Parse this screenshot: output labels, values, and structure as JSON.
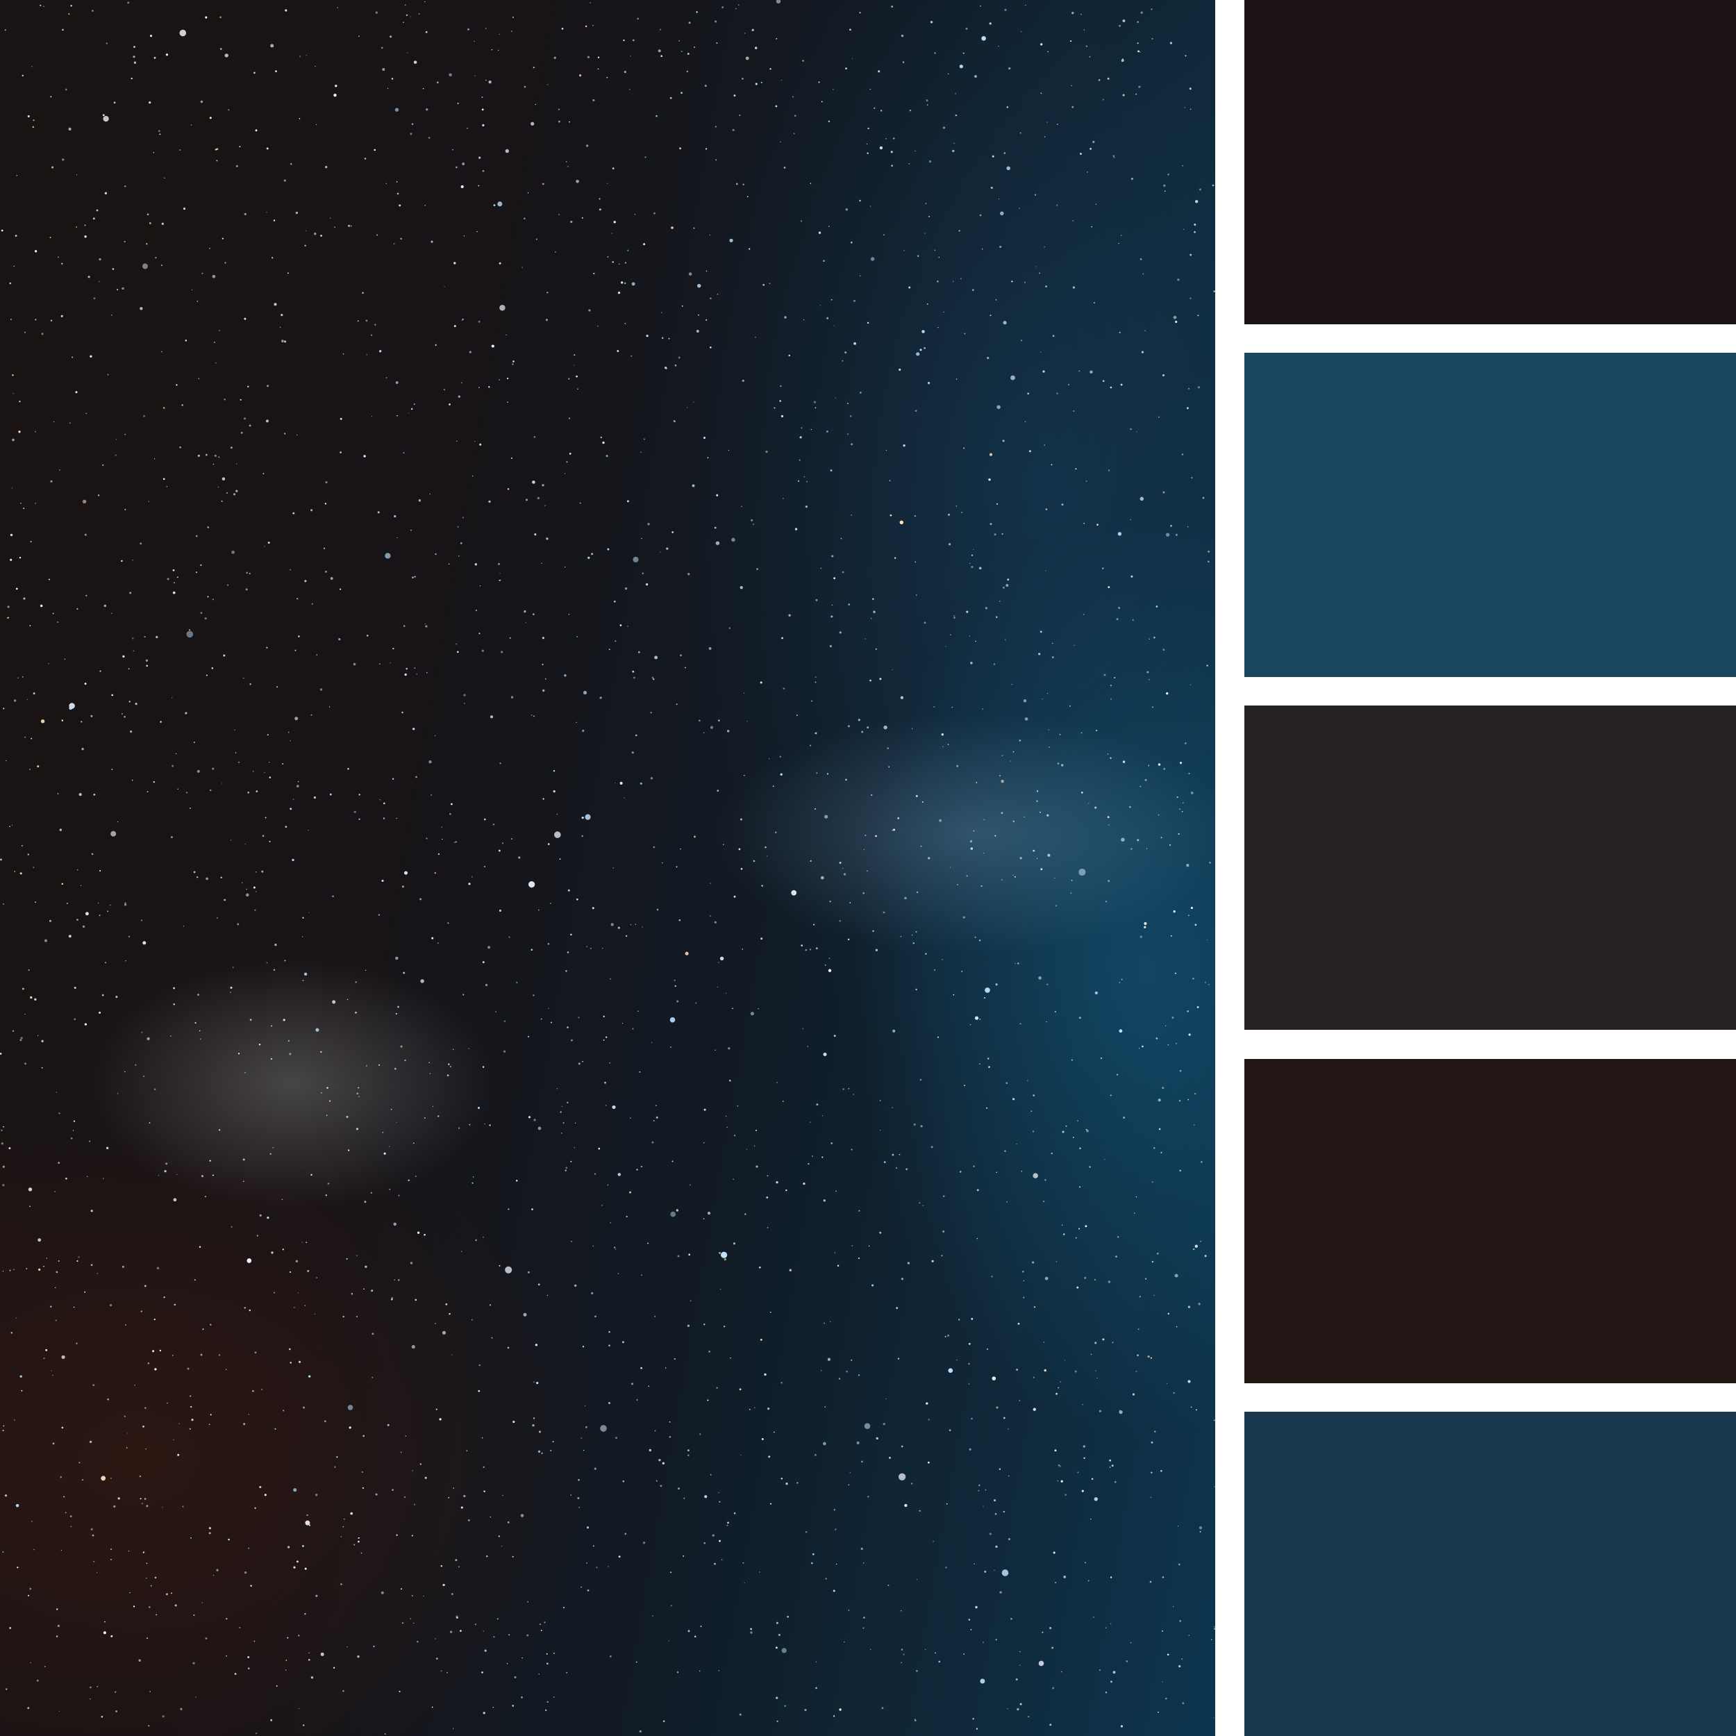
{
  "photo": {
    "description_icon": "milky-way-icon"
  },
  "palette": {
    "swatches": [
      {
        "color": "#1a1213"
      },
      {
        "color": "#1a4760"
      },
      {
        "color": "#262223"
      },
      {
        "color": "#231716"
      },
      {
        "color": "#1b394e"
      }
    ]
  }
}
